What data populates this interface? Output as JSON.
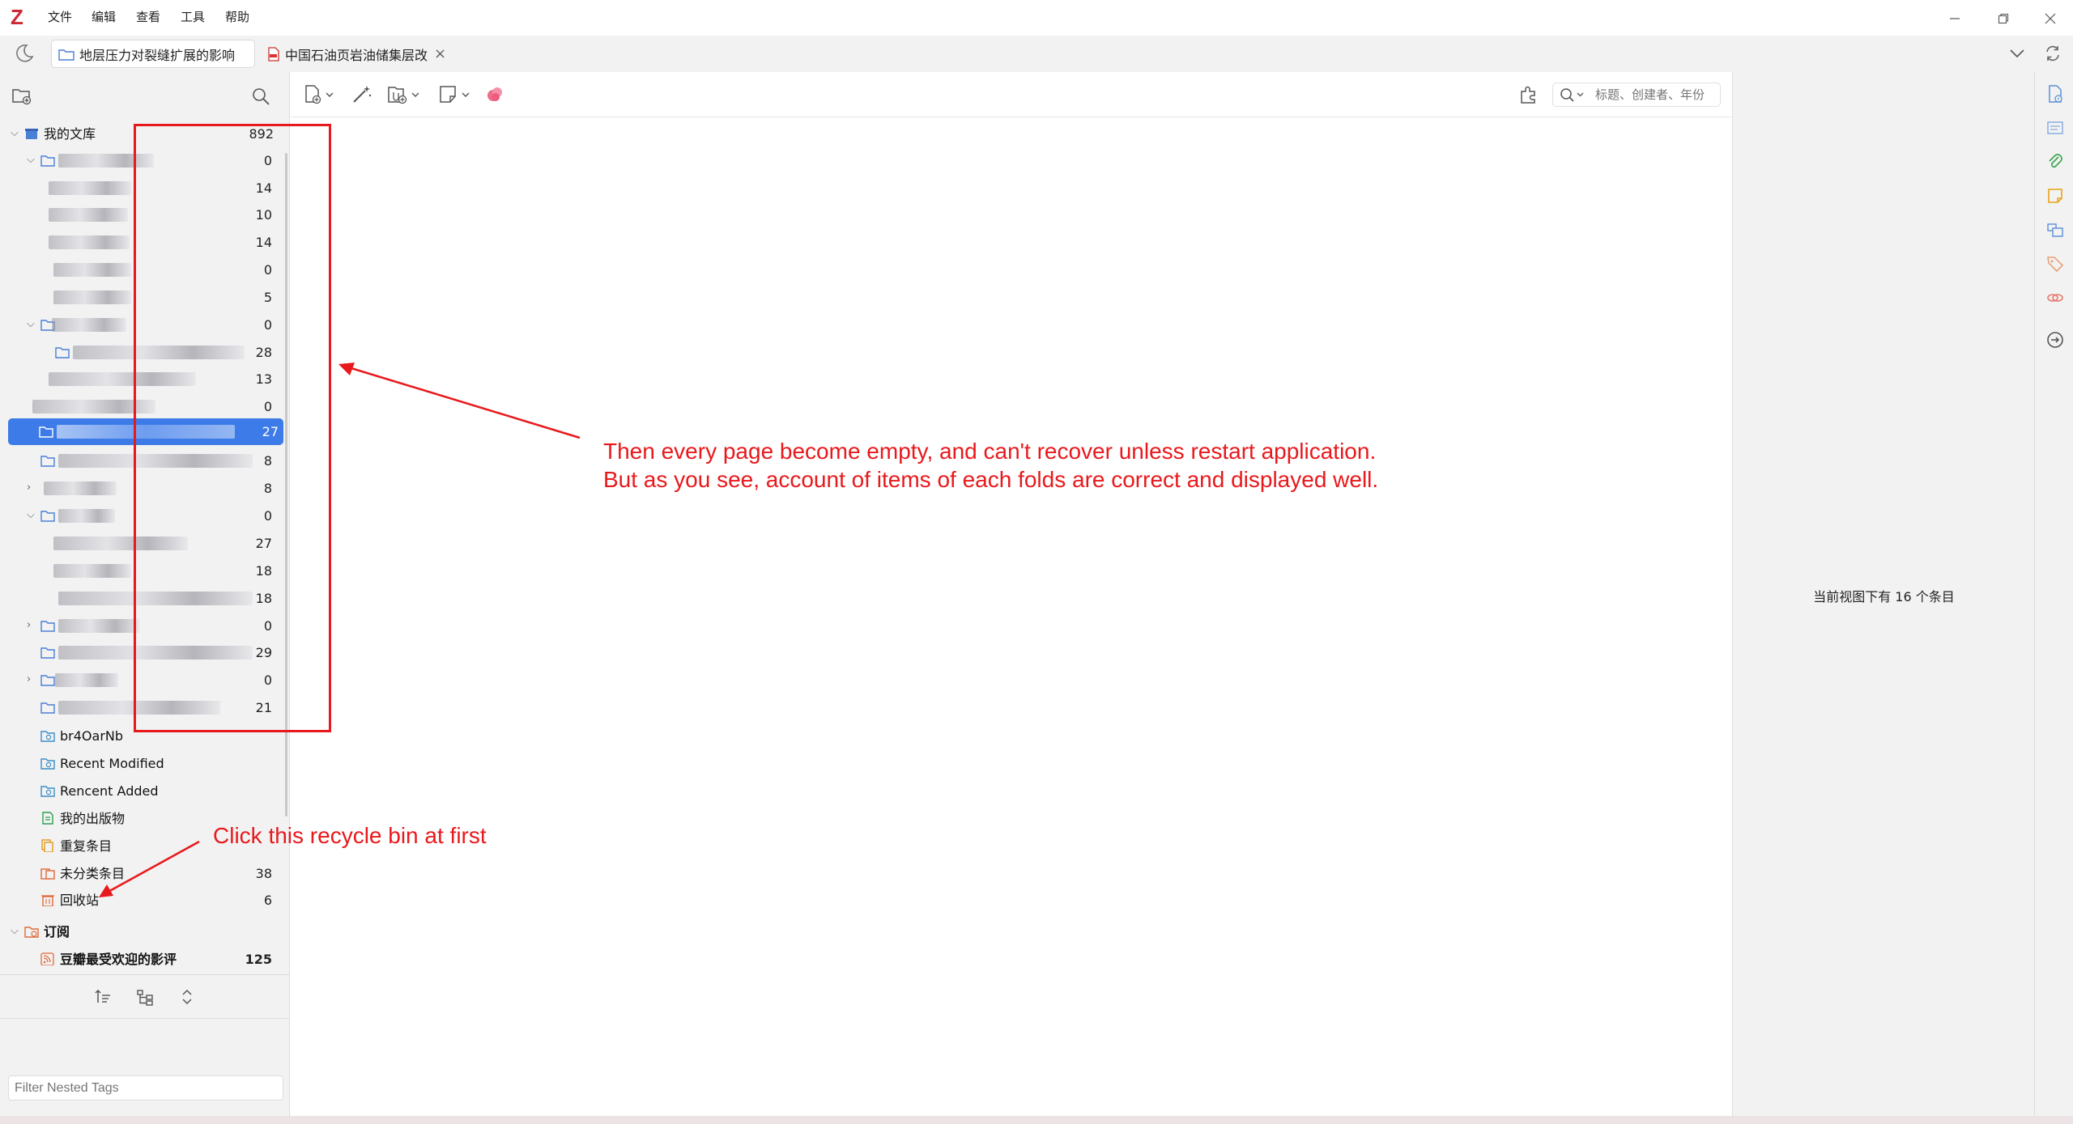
{
  "app": {
    "logo": "Z",
    "menu": [
      "文件",
      "编辑",
      "查看",
      "工具",
      "帮助"
    ]
  },
  "tabs": [
    {
      "title": "地层压力对裂缝扩展的影响"
    },
    {
      "title": "中国石油页岩油储集层改",
      "close": "×"
    }
  ],
  "library": {
    "title": "我的文库",
    "count": "892",
    "collections": [
      {
        "count": "0"
      },
      {
        "count": "14"
      },
      {
        "count": "10"
      },
      {
        "count": "14"
      },
      {
        "count": "0"
      },
      {
        "count": "5"
      },
      {
        "count": "0"
      },
      {
        "count": "28"
      },
      {
        "count": "13"
      },
      {
        "count": "0"
      },
      {
        "count": "27"
      },
      {
        "count": "8"
      },
      {
        "count": "8"
      },
      {
        "count": "0"
      },
      {
        "count": "27"
      },
      {
        "count": "18"
      },
      {
        "count": "18"
      },
      {
        "count": "0"
      },
      {
        "count": "29"
      },
      {
        "count": "0"
      },
      {
        "count": "21"
      }
    ],
    "saved_searches": [
      {
        "label": "br4OarNb"
      },
      {
        "label": "Recent Modified"
      },
      {
        "label": "Rencent Added"
      }
    ],
    "special": [
      {
        "label": "我的出版物",
        "count": ""
      },
      {
        "label": "重复条目",
        "count": ""
      },
      {
        "label": "未分类条目",
        "count": "38"
      },
      {
        "label": "回收站",
        "count": "6"
      }
    ]
  },
  "feeds": {
    "title": "订阅",
    "items": [
      {
        "label": "豆瓣最受欢迎的影评",
        "count": "125"
      }
    ]
  },
  "tag_filter": {
    "placeholder": "Filter Nested Tags"
  },
  "search": {
    "placeholder": "标题、创建者、年份"
  },
  "item_pane": {
    "message": "当前视图下有 16 个条目"
  },
  "annotations": {
    "main_line1": "Then every page become empty, and can't recover unless restart application.",
    "main_line2": "But as you see, account of items of each folds are correct and displayed well.",
    "recycle": "Click this recycle bin at first"
  },
  "colors": {
    "accent": "#3d7be8",
    "annotation": "#e8191c",
    "brand": "#cc2936"
  }
}
